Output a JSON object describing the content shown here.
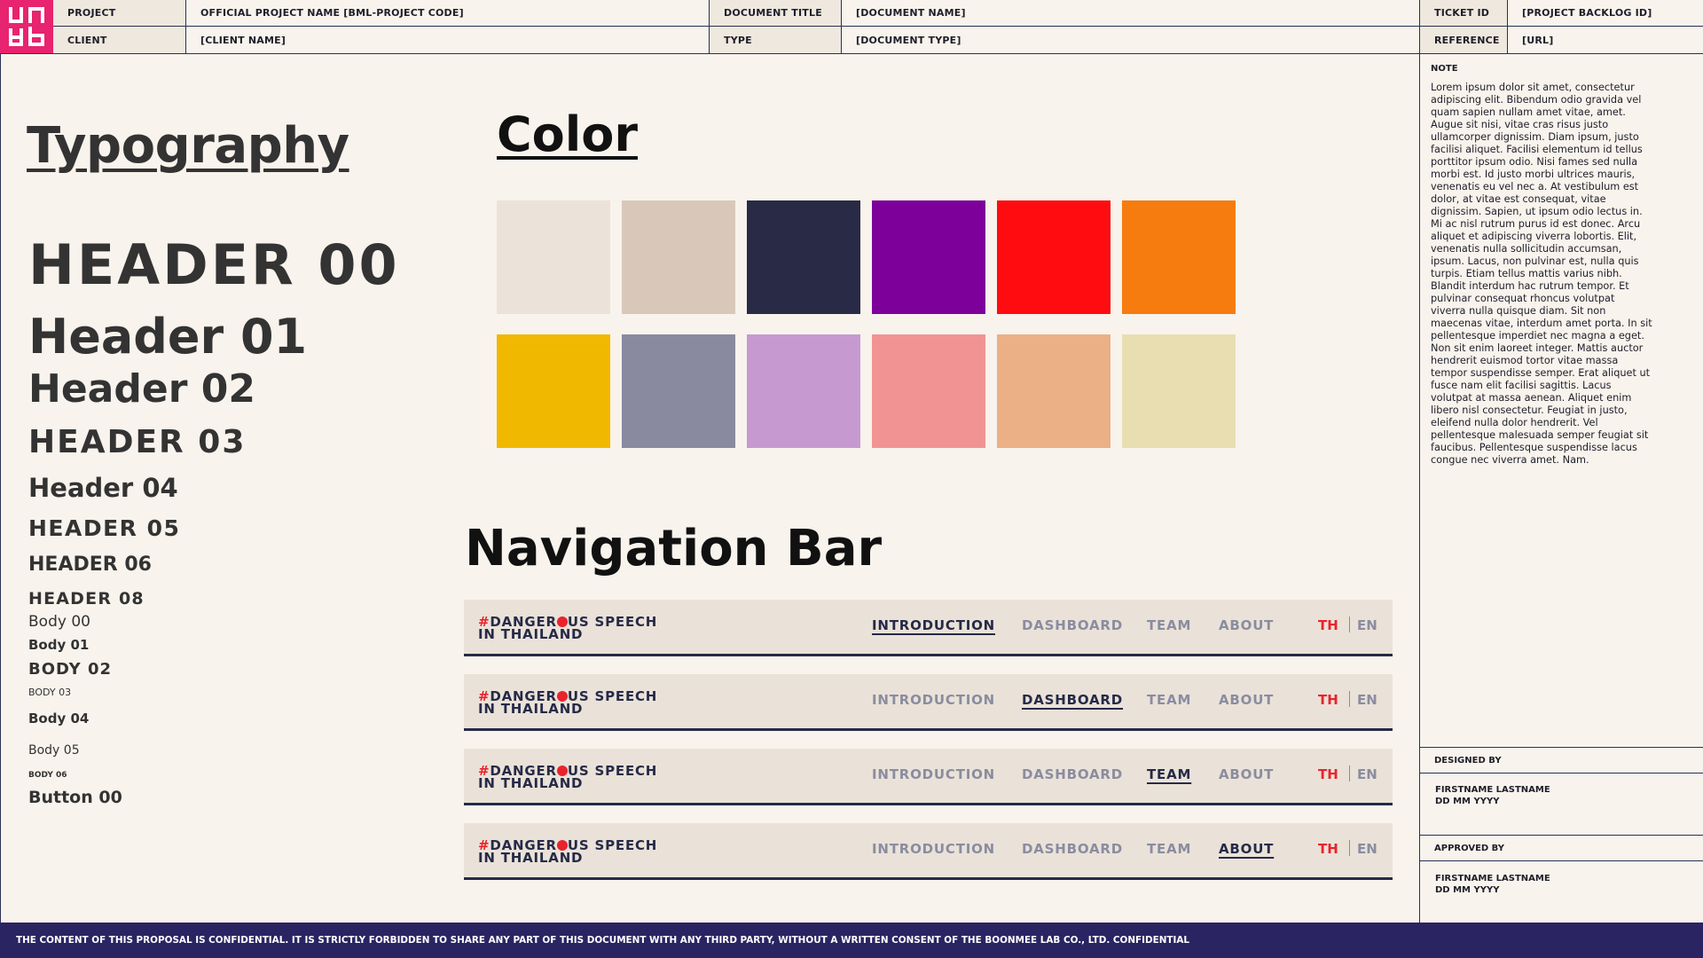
{
  "header": {
    "project_label": "PROJECT",
    "project_value": "OFFICIAL PROJECT NAME [BML-PROJECT CODE]",
    "client_label": "CLIENT",
    "client_value": "[CLIENT NAME]",
    "doc_title_label": "DOCUMENT TITLE",
    "doc_title_value": "[DOCUMENT NAME]",
    "type_label": "TYPE",
    "type_value": "[DOCUMENT TYPE]",
    "ticket_label": "TICKET ID",
    "ticket_value": "[PROJECT BACKLOG ID]",
    "reference_label": "REFERENCE",
    "reference_value": "[URL]",
    "logo_color": "#e8236f"
  },
  "typography": {
    "title": "Typography",
    "samples": {
      "h00": "HEADER 00",
      "h01": "Header 01",
      "h02": "Header 02",
      "h03": "HEADER 03",
      "h04": "Header 04",
      "h05": "HEADER 05",
      "h06": "HEADER 06",
      "h08": "HEADER 08",
      "b00": "Body 00",
      "b01": "Body 01",
      "b02": "BODY 02",
      "b03": "BODY 03",
      "b04": "Body 04",
      "b05": "Body 05",
      "b06": "BODY 06",
      "button00": "Button 00"
    }
  },
  "color": {
    "title": "Color",
    "swatches": [
      "#ebe3d9",
      "#d9c8ba",
      "#292a45",
      "#7d009a",
      "#ff0c10",
      "#f67c10",
      "#f1b800",
      "#898aa0",
      "#c69ad1",
      "#f29393",
      "#ebb085",
      "#e8deb1"
    ]
  },
  "navigation": {
    "title": "Navigation Bar",
    "brand_hash": "#",
    "brand_line1_a": "DANGER",
    "brand_line1_b": "US SPEECH",
    "brand_line2": "IN THAILAND",
    "links": [
      "INTRODUCTION",
      "DASHBOARD",
      "TEAM",
      "ABOUT"
    ],
    "lang_th": "TH",
    "lang_en": "EN",
    "variants_active": [
      0,
      1,
      2,
      3
    ],
    "accent_color": "#e8232d",
    "text_color": "#262a48"
  },
  "sidebar": {
    "note_label": "NOTE",
    "note_text": "Lorem ipsum dolor sit amet, consectetur adipiscing elit. Bibendum odio gravida vel quam sapien nullam amet vitae, amet. Augue sit nisi, vitae cras risus justo ullamcorper dignissim. Diam ipsum, justo facilisi aliquet. Facilisi elementum id tellus porttitor ipsum odio. Nisi fames sed nulla morbi est. Id justo morbi ultrices mauris, venenatis eu vel nec a. At vestibulum est dolor, at vitae est consequat, vitae dignissim. Sapien, ut ipsum odio lectus in. Mi ac nisl rutrum purus id est donec. Arcu aliquet et adipiscing viverra lobortis. Elit, venenatis nulla sollicitudin accumsan, ipsum. Lacus, non pulvinar est, nulla quis turpis. Etiam tellus mattis varius nibh. Blandit interdum hac rutrum tempor. Et pulvinar consequat rhoncus volutpat viverra nulla quisque diam. Sit non maecenas vitae, interdum amet porta. In sit pellentesque imperdiet nec magna a eget. Non sit enim laoreet integer. Mattis auctor hendrerit euismod tortor vitae massa tempor suspendisse semper. Erat aliquet ut fusce nam elit facilisi sagittis. Lacus volutpat at massa aenean. Aliquet enim libero nisl consectetur. Feugiat in justo, eleifend nulla dolor hendrerit. Vel pellentesque malesuada semper feugiat sit faucibus. Pellentesque suspendisse lacus congue nec viverra amet. Nam.",
    "designed_by_label": "DESIGNED BY",
    "designed_by_name": "FIRSTNAME LASTNAME",
    "designed_by_date": "DD MM YYYY",
    "approved_by_label": "APPROVED BY",
    "approved_by_name": "FIRSTNAME LASTNAME",
    "approved_by_date": "DD MM YYYY"
  },
  "footer": {
    "text": "THE CONTENT OF THIS PROPOSAL IS CONFIDENTIAL. IT IS STRICTLY FORBIDDEN TO SHARE ANY PART OF THIS DOCUMENT WITH ANY THIRD PARTY, WITHOUT A WRITTEN CONSENT OF THE BOONMEE LAB CO., LTD. CONFIDENTIAL"
  }
}
